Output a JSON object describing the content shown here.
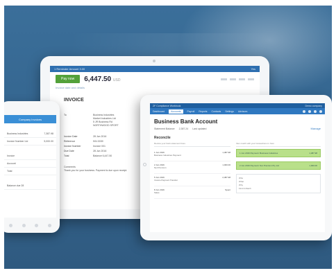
{
  "colors": {
    "background": "#356690",
    "primary_blue": "#2e6fb0",
    "pay_green": "#53a13a",
    "match_green": "#b9e08a"
  },
  "back_tablet": {
    "header_title": "1 Reminder Amount 3.00",
    "header_right": "Yes",
    "pay_button": "Pay now",
    "amount": "6,447.50",
    "amount_suffix": "USD",
    "subtitle": "Invoice date and details",
    "invoice_title": "INVOICE",
    "address_label": "To",
    "address_lines": [
      "Business Industries",
      "Market Industries Ltd",
      "5 JR Business Rd",
      "NORTHWOOD SPORT"
    ],
    "fields": [
      {
        "label": "Invoice Date",
        "value": "28 Jun 2016"
      },
      {
        "label": "Reference",
        "value": "INV-0039"
      },
      {
        "label": "Invoice Number",
        "value": "Invoice 001"
      },
      {
        "label": "Due Date",
        "value": "28 Jun 2016"
      },
      {
        "label": "Total",
        "value": "Balance 6,447.50"
      }
    ],
    "note_title": "Comments",
    "note_text": "Thank you for your business. Payment is due upon receipt."
  },
  "phone": {
    "header": "Company Invoices",
    "rows": [
      {
        "label": "Business Industries",
        "value": "7,387.98"
      },
      {
        "label": "Invoice Number Ltd",
        "value": "5,000.00"
      },
      {
        "label": "Invoice",
        "value": ""
      },
      {
        "label": "Account",
        "value": ""
      },
      {
        "label": "Total",
        "value": ""
      },
      {
        "label": "Balance due 28",
        "value": ""
      }
    ]
  },
  "front_tablet": {
    "top_left": "ZF Compliance Workbook",
    "top_right": "Demo company",
    "nav": [
      "Dashboard",
      "Accounts",
      "Payroll",
      "Reports",
      "Contacts",
      "Settings",
      "Advisors"
    ],
    "nav_active_index": 1,
    "title": "Business Bank Account",
    "meta_left": "Statement Balance",
    "meta_value": "2,387.24",
    "meta_right": "Last updated",
    "meta_link": "Manage",
    "section": "Reconcile",
    "left_col_head": "Review your bank statement lines",
    "right_col_head": "then match with your transactions in Xero",
    "left_items": [
      {
        "date": "1 Jun 2016",
        "desc": "Business Industries Payment",
        "amount": "1,387.98"
      },
      {
        "date": "2 Jun 2016",
        "desc": "Net Premium",
        "amount": "1,000.00"
      },
      {
        "date": "5 Jun 2016",
        "desc": "Invoice Payment Transfer",
        "amount": "2,387.98"
      },
      {
        "date": "8 Jun 2016",
        "desc": "Sales",
        "amount": "Spent"
      }
    ],
    "match_items": [
      {
        "left": "1 Jun 2016 Payment: Business Industries",
        "right": "1,387.98"
      },
      {
        "left": "2 Jun 2016 Payment: Net Premium Pty Ltd",
        "right": "1,000.00"
      }
    ],
    "form_lines": [
      "Who",
      "What",
      "Why",
      "Find & Match"
    ]
  }
}
